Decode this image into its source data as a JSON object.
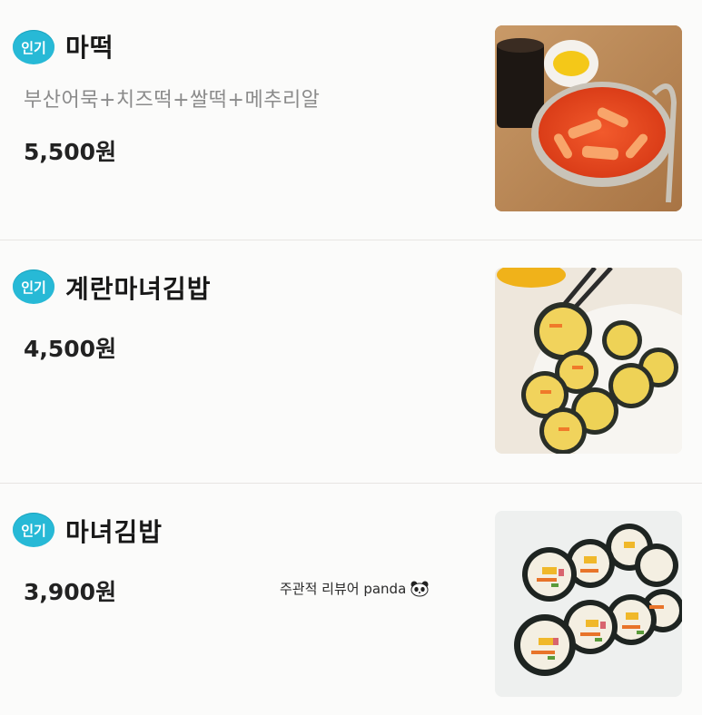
{
  "badge_label": "인기",
  "items": [
    {
      "name": "마떡",
      "description": "부산어묵+치즈떡+쌀떡+메추리알",
      "price": "5,500원",
      "photo": "tteokbokki-photo"
    },
    {
      "name": "계란마녀김밥",
      "price": "4,500원",
      "photo": "egg-gimbap-photo"
    },
    {
      "name": "마녀김밥",
      "price": "3,900원",
      "photo": "gimbap-photo"
    }
  ],
  "watermark": {
    "text": "주관적 리뷰어 panda",
    "icon": "panda-icon"
  },
  "colors": {
    "badge": "#27b9d6",
    "background": "#fbfbfa",
    "description": "#8b8b8b"
  }
}
